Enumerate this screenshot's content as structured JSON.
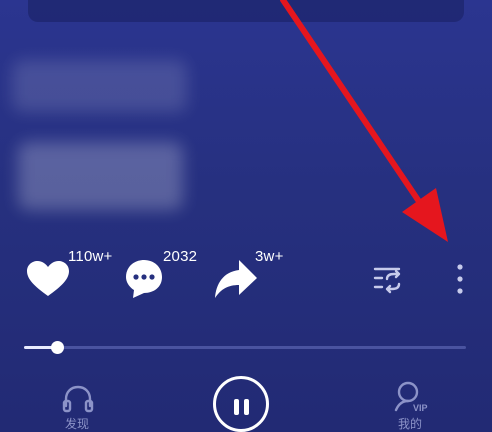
{
  "actions": {
    "like": {
      "count": "110w+"
    },
    "comment": {
      "count": "2032"
    },
    "share": {
      "count": "3w+"
    }
  },
  "player": {
    "progress": 0.075
  },
  "bottom_nav": {
    "discover_label": "发现",
    "mine_label": "我的",
    "vip_badge": "VIP"
  },
  "colors": {
    "background": "#26307f",
    "annotation_arrow": "#e5161e",
    "nav_label": "#8c93c8"
  }
}
